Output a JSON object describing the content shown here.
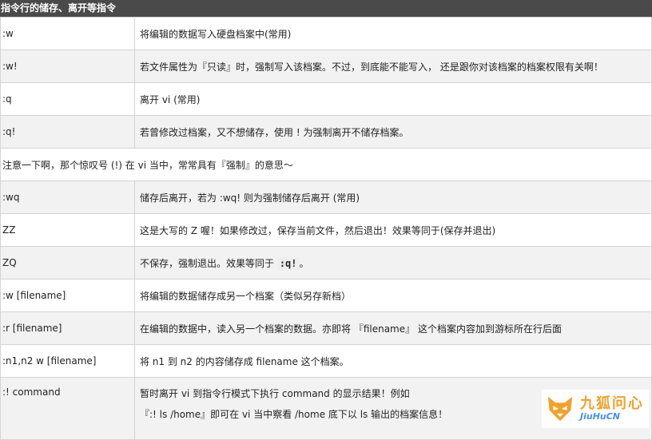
{
  "header": {
    "title": "指令行的储存、离开等指令"
  },
  "rows": [
    {
      "cmd": ":w",
      "desc": "将编辑的数据写入硬盘档案中(常用)"
    },
    {
      "cmd": ":w!",
      "desc": "若文件属性为『只读』时，强制写入该档案。不过，到底能不能写入， 还是跟你对该档案的档案权限有关啊！"
    },
    {
      "cmd": ":q",
      "desc": "离开 vi (常用)"
    },
    {
      "cmd": ":q!",
      "desc": "若曾修改过档案，又不想储存，使用 ! 为强制离开不储存档案。"
    }
  ],
  "note": {
    "text": "注意一下啊，那个惊叹号 (!) 在 vi 当中，常常具有『强制』的意思～"
  },
  "rows2": [
    {
      "cmd": ":wq",
      "desc": "储存后离开，若为 :wq! 则为强制储存后离开 (常用)"
    },
    {
      "cmd": "ZZ",
      "desc": "这是大写的 Z 喔！如果修改过，保存当前文件，然后退出！效果等同于(保存并退出)"
    },
    {
      "cmd": "ZQ",
      "desc_prefix": "不保存，强制退出。效果等同于 ",
      "desc_code": ":q!",
      "desc_suffix": "。"
    },
    {
      "cmd": ":w [filename]",
      "desc": "将编辑的数据储存成另一个档案（类似另存新档）"
    },
    {
      "cmd": ":r [filename]",
      "desc": "在编辑的数据中，读入另一个档案的数据。亦即将 『filename』 这个档案内容加到游标所在行后面"
    },
    {
      "cmd": ":n1,n2 w [filename]",
      "desc": "将 n1 到 n2 的内容储存成 filename 这个档案。"
    }
  ],
  "last": {
    "cmd": ":! command",
    "desc_line1": "暂时离开 vi 到指令行模式下执行 command 的显示结果！例如",
    "desc_line2": "『:! ls /home』即可在 vi 当中察看 /home 底下以 ls 输出的档案信息！"
  },
  "watermark": {
    "cn": "九狐问心",
    "en": "JiuHuCN",
    "color_primary": "#f0a22c",
    "color_secondary": "#4a90e2"
  }
}
